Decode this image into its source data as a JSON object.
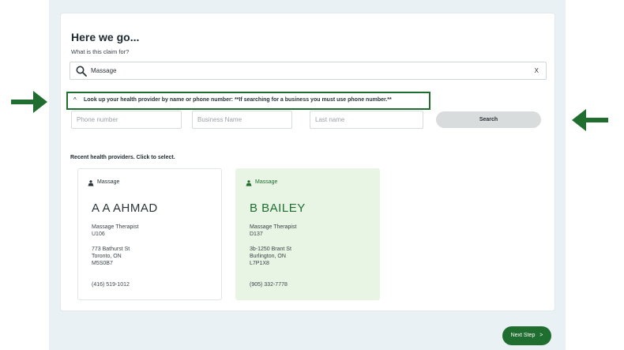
{
  "form": {
    "heading": "Here we go...",
    "claim_question": "What is this claim for?",
    "search_value": "Massage",
    "clear_label": "X"
  },
  "lookup": {
    "chevron": "^",
    "banner_text": "Look up your health provider by name or phone number: **If searching for a business you must use phone number.**",
    "phone_placeholder": "Phone number",
    "business_placeholder": "Business Name",
    "lastname_placeholder": "Last name",
    "search_label": "Search"
  },
  "recent": {
    "label": "Recent health providers. Click to select.",
    "providers": [
      {
        "category": "Massage",
        "name": "A A AHMAD",
        "profession": "Massage Therapist",
        "code": "U106",
        "address1": "773 Bathurst St",
        "address2": "Toronto, ON",
        "postal": "M5S0B7",
        "phone": "(416) 519-1012"
      },
      {
        "category": "Massage",
        "name": "B BAILEY",
        "profession": "Massage Therapist",
        "code": "D137",
        "address1": "3b-1250 Brant St",
        "address2": "Burlington, ON",
        "postal": "L7P1X8",
        "phone": "(905) 332-7778"
      }
    ]
  },
  "footer": {
    "next_label": "Next Step",
    "next_chevron": ">"
  },
  "colors": {
    "accent": "#1f6e2f",
    "selected_card": "#e8f4e4"
  }
}
